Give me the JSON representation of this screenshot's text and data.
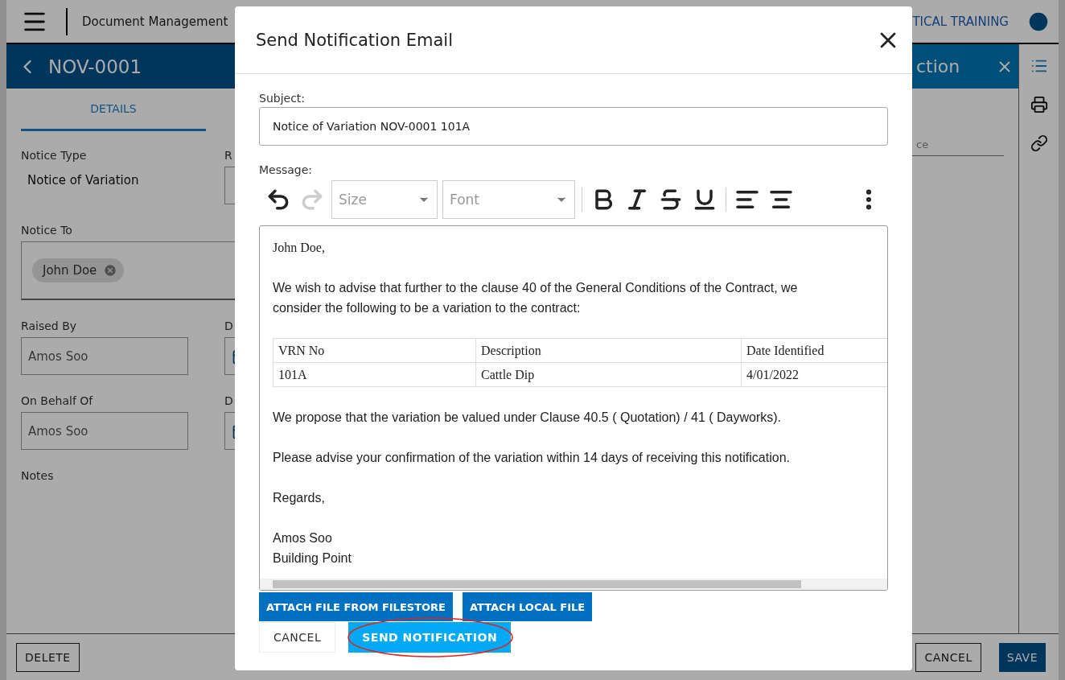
{
  "app_bar": {
    "title": "Document Management",
    "org": "TICAL TRAINING"
  },
  "record": {
    "title": "NOV-0001",
    "tabs": [
      {
        "label": "DETAILS",
        "selected": true
      }
    ],
    "fields": [
      {
        "label": "Notice Type",
        "kind": "text",
        "value": "Notice of Variation"
      },
      {
        "label": "R",
        "kind": "input"
      },
      {
        "label": "Notice To",
        "kind": "chips",
        "chips": [
          "John Doe"
        ]
      },
      {
        "label": "Raised By",
        "kind": "input",
        "value": "Amos Soo"
      },
      {
        "label": "D",
        "kind": "date"
      },
      {
        "label": "On Behalf Of",
        "kind": "input",
        "value": "Amos Soo"
      },
      {
        "label": "D",
        "kind": "date"
      },
      {
        "label": "Notes",
        "kind": "label"
      }
    ],
    "side_panel": {
      "title": "ction",
      "placeholder": "ce"
    },
    "footer_buttons": [
      {
        "label": "DELETE",
        "kind": "outline"
      },
      {
        "label": "CANCEL",
        "kind": "outline"
      },
      {
        "label": "SAVE",
        "kind": "primary"
      }
    ]
  },
  "dialog": {
    "title": "Send Notification Email",
    "subject": {
      "label": "Subject:",
      "value": "Notice of Variation NOV-0001 101A"
    },
    "message": {
      "label": "Message:",
      "toolbar": [
        {
          "kind": "undo",
          "disabled": false
        },
        {
          "kind": "redo",
          "disabled": true
        },
        {
          "kind": "select",
          "placeholder": "Size"
        },
        {
          "kind": "select",
          "placeholder": "Font"
        },
        {
          "kind": "bold",
          "disabled": false
        },
        {
          "kind": "italic",
          "disabled": false
        },
        {
          "kind": "strike",
          "disabled": false
        },
        {
          "kind": "underline",
          "disabled": false
        },
        {
          "kind": "align-left",
          "disabled": false
        },
        {
          "kind": "align-center",
          "disabled": false
        },
        {
          "kind": "more",
          "disabled": false
        }
      ],
      "greeting": "John Doe,",
      "intro": "We wish to advise that further to the clause 40 of the General Conditions of the Contract, we consider the following to be a variation to the contract:",
      "table": {
        "columns": [
          "VRN No",
          "Description",
          "Date Identified"
        ],
        "rows": [
          [
            "101A",
            "Cattle Dip",
            "4/01/2022"
          ]
        ]
      },
      "paragraphs": [
        "We propose that the variation be valued under Clause 40.5 ( Quotation) / 41 ( Dayworks).",
        "Please advise your confirmation of the variation within 14 days of receiving this notification.",
        "Regards,"
      ],
      "signature": [
        "Amos Soo",
        "Building Point"
      ]
    },
    "attach_buttons": [
      "ATTACH FILE FROM FILESTORE",
      "ATTACH LOCAL FILE"
    ],
    "actions": [
      {
        "label": "CANCEL",
        "kind": "text"
      },
      {
        "label": "SEND NOTIFICATION",
        "kind": "primary",
        "highlighted": true
      }
    ]
  }
}
